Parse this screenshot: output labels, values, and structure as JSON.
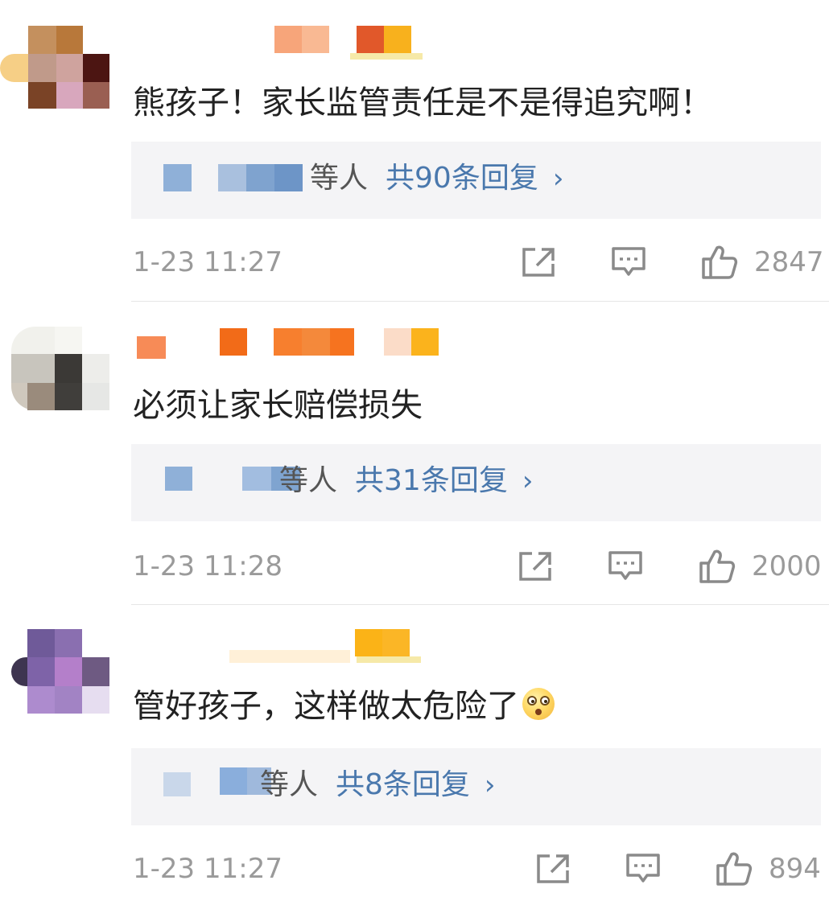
{
  "comments": [
    {
      "text": "熊孩子！家长监管责任是不是得追究啊！",
      "replies": {
        "who": "等人",
        "count": "共90条回复",
        "chevron": "›"
      },
      "time": "1-23 11:27",
      "likes": "2847"
    },
    {
      "text": "必须让家长赔偿损失",
      "replies": {
        "who": "等人",
        "count": "共31条回复",
        "chevron": "›"
      },
      "time": "1-23 11:28",
      "likes": "2000"
    },
    {
      "text": "管好孩子，这样做太危险了",
      "emoji": "astonished-face-emoji",
      "replies": {
        "who": "等人",
        "count": "共8条回复",
        "chevron": "›"
      },
      "time": "1-23 11:27",
      "likes": "894"
    }
  ],
  "icons": {
    "share": "share-icon",
    "comment": "comment-icon",
    "like": "thumbs-up-icon"
  },
  "colors": {
    "reply_link": "#4a78ad",
    "meta_text": "#9a9a9a",
    "reply_bg": "#f4f4f6"
  }
}
